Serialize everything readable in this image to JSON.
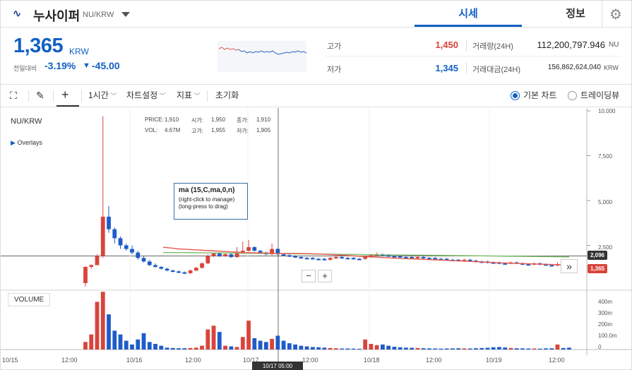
{
  "header": {
    "coin_name": "누사이퍼",
    "coin_pair": "NU/KRW",
    "tabs": [
      "시세",
      "정보"
    ]
  },
  "price": {
    "current": "1,365",
    "unit": "KRW",
    "change_label": "전일대비",
    "change_pct": "-3.19%",
    "change_arrow": "▼",
    "change_val": "-45.00"
  },
  "stats": {
    "high_label": "고가",
    "high_value": "1,450",
    "low_label": "저가",
    "low_value": "1,345",
    "volume_label": "거래량(24H)",
    "volume_value": "112,200,797.946",
    "volume_unit": "NU",
    "amount_label": "거래대금(24H)",
    "amount_value": "156,862,624,040",
    "amount_unit": "KRW"
  },
  "toolbar": {
    "interval": "1시간",
    "chart_settings": "차트설정",
    "indicators": "지표",
    "reset": "초기화",
    "basic_chart": "기본 차트",
    "tradingview": "트레이딩뷰"
  },
  "chart_legend": {
    "pair": "NU/KRW",
    "overlays": "Overlays",
    "price_lbl": "PRICE:",
    "price_val": "1,910",
    "open_lbl": "시가:",
    "open_val": "1,950",
    "close_lbl": "종가:",
    "close_val": "1,910",
    "vol_lbl": "VOL:",
    "vol_val": "4.67M",
    "high_lbl": "고가:",
    "high_val": "1,955",
    "low_lbl": "저가:",
    "low_val": "1,905"
  },
  "ma_box": {
    "title": "ma (15,C,ma,0,n)",
    "hint1": "(right-click to manage)",
    "hint2": "(long-press to drag)"
  },
  "volume_label": "VOLUME",
  "zoom": {
    "minus": "−",
    "plus": "+",
    "forward": "»"
  },
  "price_tags": {
    "ma": "2,096",
    "last": "1,365"
  },
  "y_ticks": [
    "10,000",
    "7,500",
    "5,000",
    "2,500"
  ],
  "vol_ticks": [
    "400m",
    "300m",
    "200m",
    "100.0m",
    "0"
  ],
  "x_ticks": [
    "10/15",
    "12:00",
    "10/16",
    "12:00",
    "10/17",
    "12:00",
    "10/18",
    "12:00",
    "10/19",
    "12:00"
  ],
  "crosshair_time": "10/17 05:00",
  "colors": {
    "up": "#d9443b",
    "down": "#1f5cc8",
    "accent": "#1261c4",
    "ma": "#e8584d",
    "ma2": "#7cba6b"
  },
  "chart_data": {
    "type": "candlestick",
    "ylim": [
      0,
      10000
    ],
    "volume_ylim": [
      0,
      450
    ],
    "candles": [
      [
        1,
        400,
        1300,
        200,
        1350,
        60
      ],
      [
        1,
        1300,
        1400,
        1200,
        1450,
        120
      ],
      [
        1,
        1400,
        1900,
        1400,
        2000,
        380
      ],
      [
        1,
        1900,
        4100,
        1800,
        9700,
        460
      ],
      [
        0,
        4100,
        3400,
        3200,
        4700,
        280
      ],
      [
        0,
        3400,
        2900,
        2600,
        3500,
        150
      ],
      [
        0,
        2900,
        2500,
        2300,
        3000,
        120
      ],
      [
        0,
        2500,
        2300,
        2200,
        2600,
        70
      ],
      [
        0,
        2300,
        2100,
        2000,
        2500,
        40
      ],
      [
        0,
        2100,
        1800,
        1700,
        2200,
        80
      ],
      [
        0,
        1800,
        1600,
        1550,
        1900,
        130
      ],
      [
        0,
        1600,
        1400,
        1350,
        1700,
        60
      ],
      [
        0,
        1400,
        1300,
        1250,
        1500,
        45
      ],
      [
        0,
        1300,
        1200,
        1150,
        1350,
        30
      ],
      [
        0,
        1200,
        1100,
        1050,
        1250,
        15
      ],
      [
        0,
        1100,
        1050,
        1000,
        1150,
        12
      ],
      [
        0,
        1050,
        1000,
        950,
        1100,
        10
      ],
      [
        0,
        1000,
        950,
        900,
        1050,
        10
      ],
      [
        1,
        950,
        1100,
        900,
        1150,
        12
      ],
      [
        1,
        1100,
        1250,
        1050,
        1300,
        15
      ],
      [
        1,
        1250,
        1500,
        1200,
        1550,
        30
      ],
      [
        1,
        1500,
        1900,
        1450,
        2000,
        160
      ],
      [
        1,
        1900,
        2050,
        1850,
        2100,
        190
      ],
      [
        0,
        2050,
        1900,
        1850,
        2100,
        140
      ],
      [
        1,
        1900,
        2000,
        1850,
        2050,
        30
      ],
      [
        0,
        2000,
        1850,
        1800,
        2050,
        25
      ],
      [
        1,
        1850,
        2100,
        1800,
        2400,
        20
      ],
      [
        1,
        2100,
        2200,
        2050,
        2700,
        100
      ],
      [
        1,
        2200,
        2400,
        2150,
        2800,
        230
      ],
      [
        0,
        2400,
        2200,
        2150,
        2450,
        90
      ],
      [
        0,
        2200,
        2100,
        2050,
        2250,
        70
      ],
      [
        0,
        2100,
        2000,
        1950,
        2150,
        60
      ],
      [
        1,
        2000,
        2300,
        1950,
        2600,
        85
      ],
      [
        0,
        2300,
        2000,
        1950,
        2350,
        110
      ],
      [
        0,
        2000,
        1950,
        1900,
        2050,
        70
      ],
      [
        0,
        1950,
        1900,
        1850,
        2000,
        50
      ],
      [
        0,
        1900,
        1850,
        1800,
        1950,
        40
      ],
      [
        0,
        1850,
        1800,
        1750,
        1900,
        30
      ],
      [
        0,
        1800,
        1800,
        1750,
        1850,
        25
      ],
      [
        0,
        1800,
        1750,
        1700,
        1850,
        20
      ],
      [
        0,
        1750,
        1750,
        1700,
        1800,
        18
      ],
      [
        0,
        1750,
        1700,
        1650,
        1800,
        15
      ],
      [
        1,
        1700,
        1800,
        1650,
        1850,
        12
      ],
      [
        1,
        1800,
        1850,
        1750,
        1900,
        10
      ],
      [
        0,
        1850,
        1800,
        1750,
        1900,
        8
      ],
      [
        0,
        1800,
        1800,
        1750,
        1850,
        8
      ],
      [
        0,
        1800,
        1750,
        1700,
        1850,
        7
      ],
      [
        0,
        1750,
        1750,
        1700,
        1800,
        6
      ],
      [
        1,
        1750,
        1850,
        1700,
        1900,
        80
      ],
      [
        1,
        1850,
        1950,
        1800,
        2000,
        45
      ],
      [
        1,
        1950,
        2000,
        1900,
        2100,
        35
      ],
      [
        0,
        2000,
        1950,
        1900,
        2050,
        40
      ],
      [
        0,
        1950,
        1900,
        1850,
        2000,
        30
      ],
      [
        0,
        1900,
        1900,
        1850,
        1950,
        22
      ],
      [
        0,
        1900,
        1850,
        1800,
        1950,
        18
      ],
      [
        0,
        1850,
        1850,
        1800,
        1900,
        15
      ],
      [
        0,
        1850,
        1800,
        1750,
        1900,
        14
      ],
      [
        1,
        1800,
        1850,
        1750,
        1900,
        12
      ],
      [
        0,
        1850,
        1800,
        1750,
        1900,
        10
      ],
      [
        0,
        1800,
        1800,
        1750,
        1850,
        9
      ],
      [
        0,
        1800,
        1750,
        1700,
        1850,
        8
      ],
      [
        0,
        1750,
        1750,
        1700,
        1800,
        7
      ],
      [
        0,
        1750,
        1700,
        1650,
        1800,
        8
      ],
      [
        0,
        1700,
        1700,
        1650,
        1750,
        9
      ],
      [
        0,
        1700,
        1650,
        1600,
        1750,
        10
      ],
      [
        1,
        1650,
        1700,
        1600,
        1750,
        9
      ],
      [
        0,
        1700,
        1650,
        1600,
        1750,
        8
      ],
      [
        0,
        1650,
        1600,
        1550,
        1700,
        10
      ],
      [
        0,
        1600,
        1600,
        1550,
        1650,
        12
      ],
      [
        0,
        1600,
        1550,
        1500,
        1650,
        14
      ],
      [
        0,
        1550,
        1550,
        1500,
        1600,
        18
      ],
      [
        0,
        1550,
        1500,
        1450,
        1600,
        20
      ],
      [
        0,
        1500,
        1500,
        1450,
        1550,
        16
      ],
      [
        1,
        1500,
        1550,
        1450,
        1600,
        12
      ],
      [
        0,
        1550,
        1500,
        1450,
        1600,
        10
      ],
      [
        0,
        1500,
        1450,
        1400,
        1550,
        9
      ],
      [
        0,
        1450,
        1450,
        1400,
        1500,
        8
      ],
      [
        1,
        1450,
        1500,
        1400,
        1550,
        8
      ],
      [
        0,
        1500,
        1450,
        1400,
        1550,
        7
      ],
      [
        0,
        1450,
        1400,
        1350,
        1500,
        9
      ],
      [
        0,
        1400,
        1400,
        1350,
        1450,
        10
      ],
      [
        1,
        1400,
        1450,
        1350,
        1550,
        40
      ],
      [
        0,
        1450,
        1400,
        1350,
        1500,
        12
      ],
      [
        0,
        1400,
        1365,
        1345,
        1450,
        15
      ]
    ],
    "ma_series": [
      2400,
      2300,
      2250,
      2200,
      2150,
      2100,
      2080,
      2050,
      2050,
      2040,
      2000,
      1950,
      1900,
      1850,
      1800,
      1760,
      1720,
      1680,
      1640,
      1600,
      1560,
      1520,
      1490,
      1460,
      1430,
      1400
    ],
    "ma2_series": [
      2100,
      2100,
      2090,
      2080,
      2070,
      2060,
      2050,
      2040,
      2030,
      2020,
      2010,
      2000,
      1990,
      1980,
      1970,
      1960,
      1950,
      1940,
      1930,
      1920,
      1910,
      1900,
      1890,
      1880,
      1870,
      1860
    ]
  }
}
